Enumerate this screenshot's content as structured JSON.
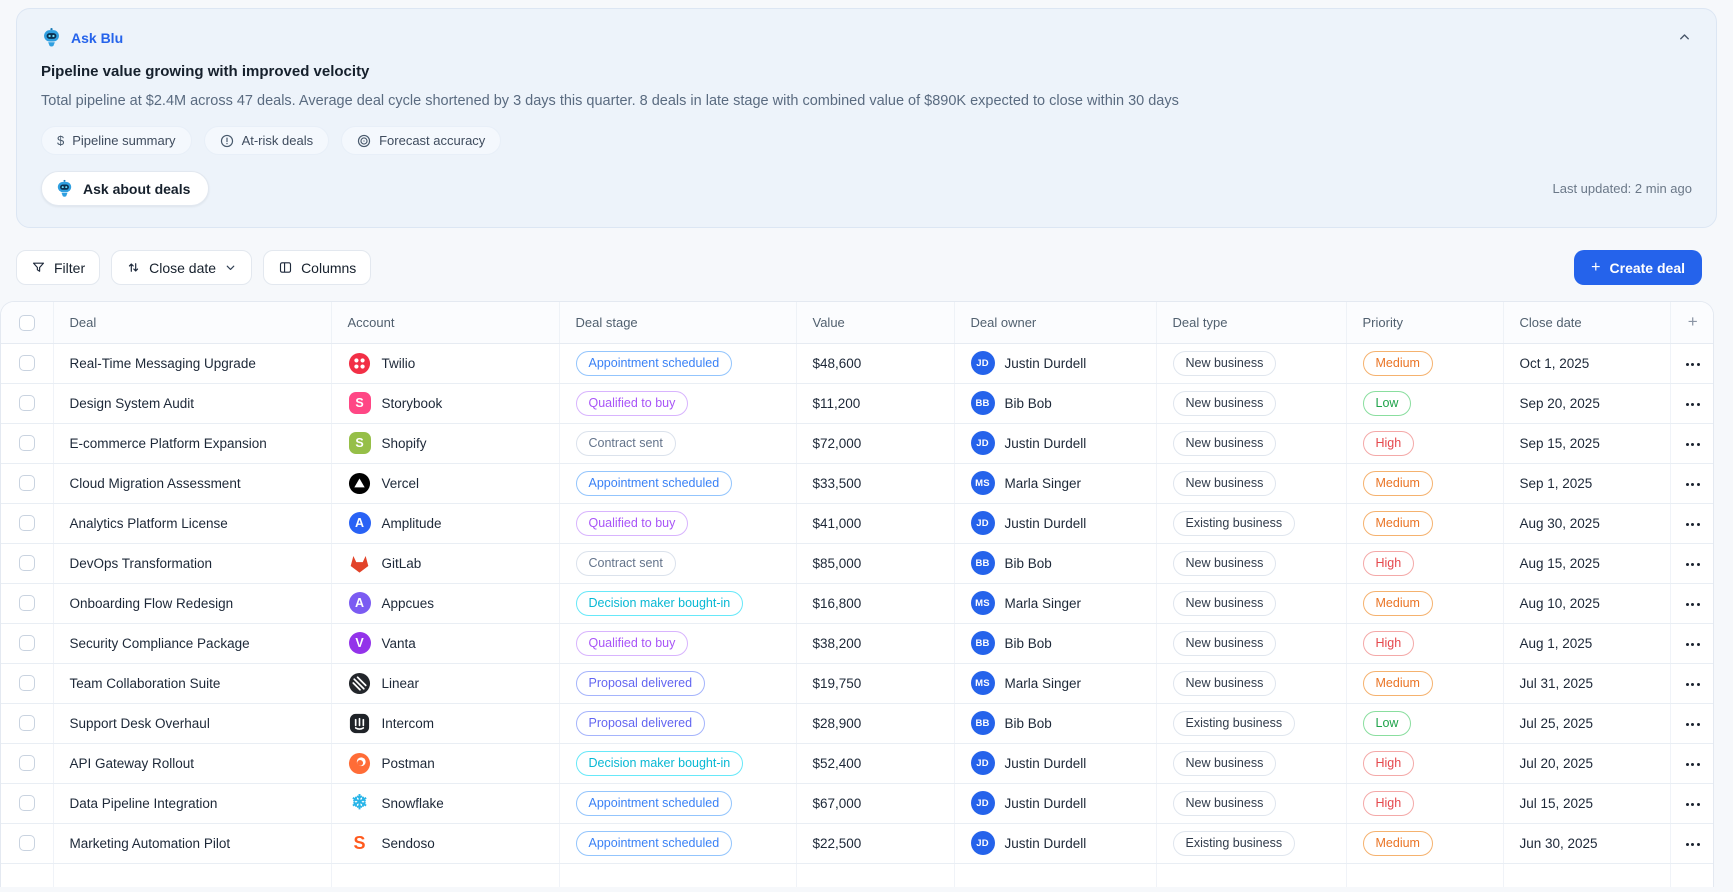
{
  "assistant_panel": {
    "title": "Ask Blu",
    "headline": "Pipeline value growing with improved velocity",
    "summary": "Total pipeline at $2.4M across 47 deals. Average deal cycle shortened by 3 days this quarter. 8 deals in late stage with combined value of $890K expected to close within 30 days",
    "chips": [
      {
        "icon": "dollar-icon",
        "label": "Pipeline summary"
      },
      {
        "icon": "alert-circle-icon",
        "label": "At-risk deals"
      },
      {
        "icon": "target-icon",
        "label": "Forecast accuracy"
      }
    ],
    "ask_button_label": "Ask about deals",
    "last_updated": "Last updated: 2 min ago",
    "collapse_icon": "chevron-up-icon",
    "bot_icon": "robot-icon"
  },
  "toolbar": {
    "filter_label": "Filter",
    "filter_icon": "funnel-icon",
    "sort_label": "Close date",
    "sort_icon": "arrows-up-down-icon",
    "sort_chevron_icon": "chevron-down-icon",
    "columns_label": "Columns",
    "columns_icon": "columns-icon",
    "create_deal_label": "Create deal",
    "create_deal_icon": "plus-icon"
  },
  "table": {
    "headers": [
      "Deal",
      "Account",
      "Deal stage",
      "Value",
      "Deal owner",
      "Deal type",
      "Priority",
      "Close date"
    ],
    "add_column_label": "+",
    "row_menu_icon": "ellipsis-icon",
    "rows": [
      {
        "deal": "Real-Time Messaging Upgrade",
        "account": {
          "name": "Twilio",
          "logo": "twilio",
          "bg": "#f22f46"
        },
        "stage": {
          "label": "Appointment scheduled",
          "color": "blue"
        },
        "value": "$48,600",
        "owner": {
          "initials": "JD",
          "name": "Justin Durdell"
        },
        "deal_type": "New business",
        "priority": {
          "label": "Medium",
          "color": "orange"
        },
        "close_date": "Oct 1, 2025"
      },
      {
        "deal": "Design System Audit",
        "account": {
          "name": "Storybook",
          "logo": "letter",
          "letter": "S",
          "bg": "#ff4785",
          "shape": "rounded"
        },
        "stage": {
          "label": "Qualified to buy",
          "color": "purple"
        },
        "value": "$11,200",
        "owner": {
          "initials": "BB",
          "name": "Bib Bob"
        },
        "deal_type": "New business",
        "priority": {
          "label": "Low",
          "color": "green"
        },
        "close_date": "Sep 20, 2025"
      },
      {
        "deal": "E-commerce Platform Expansion",
        "account": {
          "name": "Shopify",
          "logo": "letter",
          "letter": "S",
          "bg": "#96bf48",
          "shape": "rounded"
        },
        "stage": {
          "label": "Contract sent",
          "color": "gray"
        },
        "value": "$72,000",
        "owner": {
          "initials": "JD",
          "name": "Justin Durdell"
        },
        "deal_type": "New business",
        "priority": {
          "label": "High",
          "color": "red"
        },
        "close_date": "Sep 15, 2025"
      },
      {
        "deal": "Cloud Migration Assessment",
        "account": {
          "name": "Vercel",
          "logo": "vercel",
          "bg": "#000000"
        },
        "stage": {
          "label": "Appointment scheduled",
          "color": "blue"
        },
        "value": "$33,500",
        "owner": {
          "initials": "MS",
          "name": "Marla Singer"
        },
        "deal_type": "New business",
        "priority": {
          "label": "Medium",
          "color": "orange"
        },
        "close_date": "Sep 1, 2025"
      },
      {
        "deal": "Analytics Platform License",
        "account": {
          "name": "Amplitude",
          "logo": "letter",
          "letter": "A",
          "bg": "#2962f5",
          "shape": "circle"
        },
        "stage": {
          "label": "Qualified to buy",
          "color": "purple"
        },
        "value": "$41,000",
        "owner": {
          "initials": "JD",
          "name": "Justin Durdell"
        },
        "deal_type": "Existing business",
        "priority": {
          "label": "Medium",
          "color": "orange"
        },
        "close_date": "Aug 30, 2025"
      },
      {
        "deal": "DevOps Transformation",
        "account": {
          "name": "GitLab",
          "logo": "gitlab",
          "bg": "#e24329"
        },
        "stage": {
          "label": "Contract sent",
          "color": "gray"
        },
        "value": "$85,000",
        "owner": {
          "initials": "BB",
          "name": "Bib Bob"
        },
        "deal_type": "New business",
        "priority": {
          "label": "High",
          "color": "red"
        },
        "close_date": "Aug 15, 2025"
      },
      {
        "deal": "Onboarding Flow Redesign",
        "account": {
          "name": "Appcues",
          "logo": "letter",
          "letter": "A",
          "bg": "#7b5bf2",
          "shape": "circle"
        },
        "stage": {
          "label": "Decision maker bought-in",
          "color": "cyan"
        },
        "value": "$16,800",
        "owner": {
          "initials": "MS",
          "name": "Marla Singer"
        },
        "deal_type": "New business",
        "priority": {
          "label": "Medium",
          "color": "orange"
        },
        "close_date": "Aug 10, 2025"
      },
      {
        "deal": "Security Compliance Package",
        "account": {
          "name": "Vanta",
          "logo": "letter",
          "letter": "V",
          "bg": "#9333ea",
          "shape": "circle"
        },
        "stage": {
          "label": "Qualified to buy",
          "color": "purple"
        },
        "value": "$38,200",
        "owner": {
          "initials": "BB",
          "name": "Bib Bob"
        },
        "deal_type": "New business",
        "priority": {
          "label": "High",
          "color": "red"
        },
        "close_date": "Aug 1, 2025"
      },
      {
        "deal": "Team Collaboration Suite",
        "account": {
          "name": "Linear",
          "logo": "linear",
          "bg": "#23262b"
        },
        "stage": {
          "label": "Proposal delivered",
          "color": "indigo"
        },
        "value": "$19,750",
        "owner": {
          "initials": "MS",
          "name": "Marla Singer"
        },
        "deal_type": "New business",
        "priority": {
          "label": "Medium",
          "color": "orange"
        },
        "close_date": "Jul 31, 2025"
      },
      {
        "deal": "Support Desk Overhaul",
        "account": {
          "name": "Intercom",
          "logo": "intercom",
          "bg": "#1f2328"
        },
        "stage": {
          "label": "Proposal delivered",
          "color": "indigo"
        },
        "value": "$28,900",
        "owner": {
          "initials": "BB",
          "name": "Bib Bob"
        },
        "deal_type": "Existing business",
        "priority": {
          "label": "Low",
          "color": "green"
        },
        "close_date": "Jul 25, 2025"
      },
      {
        "deal": "API Gateway Rollout",
        "account": {
          "name": "Postman",
          "logo": "postman",
          "bg": "#ff6c37"
        },
        "stage": {
          "label": "Decision maker bought-in",
          "color": "cyan"
        },
        "value": "$52,400",
        "owner": {
          "initials": "JD",
          "name": "Justin Durdell"
        },
        "deal_type": "New business",
        "priority": {
          "label": "High",
          "color": "red"
        },
        "close_date": "Jul 20, 2025"
      },
      {
        "deal": "Data Pipeline Integration",
        "account": {
          "name": "Snowflake",
          "logo": "snowflake",
          "fg": "#29b5e8"
        },
        "stage": {
          "label": "Appointment scheduled",
          "color": "blue"
        },
        "value": "$67,000",
        "owner": {
          "initials": "JD",
          "name": "Justin Durdell"
        },
        "deal_type": "New business",
        "priority": {
          "label": "High",
          "color": "red"
        },
        "close_date": "Jul 15, 2025"
      },
      {
        "deal": "Marketing Automation Pilot",
        "account": {
          "name": "Sendoso",
          "logo": "sendoso",
          "fg": "#ff5a1e"
        },
        "stage": {
          "label": "Appointment scheduled",
          "color": "blue"
        },
        "value": "$22,500",
        "owner": {
          "initials": "JD",
          "name": "Justin Durdell"
        },
        "deal_type": "Existing business",
        "priority": {
          "label": "Medium",
          "color": "orange"
        },
        "close_date": "Jun 30, 2025"
      }
    ]
  },
  "colors": {
    "accent": "#2563eb",
    "avatar": "#2563eb",
    "stage": {
      "blue": {
        "text": "#3b82f6",
        "border": "#93c5fd"
      },
      "purple": {
        "text": "#a855f7",
        "border": "#d8b4fe"
      },
      "gray": {
        "text": "#64748b",
        "border": "#dbe2ec"
      },
      "cyan": {
        "text": "#08b8d4",
        "border": "#67e8f9"
      },
      "indigo": {
        "text": "#6366f1",
        "border": "#a5b4fc"
      }
    },
    "priority": {
      "orange": {
        "text": "#ea7425",
        "border": "#f5b26f"
      },
      "green": {
        "text": "#1fa34a",
        "border": "#8ade9f"
      },
      "red": {
        "text": "#e5484d",
        "border": "#f4a9a8"
      }
    }
  }
}
